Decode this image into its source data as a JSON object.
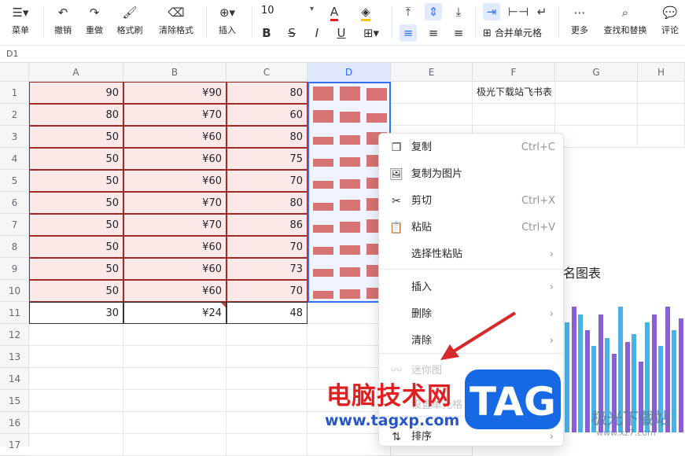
{
  "toolbar": {
    "menu": "菜单",
    "undo": "撤销",
    "redo": "重做",
    "format_painter": "格式刷",
    "clear_format": "清除格式",
    "insert": "插入",
    "font_size": "10",
    "merge_cells": "合并单元格",
    "more": "更多",
    "find_replace": "查找和替换",
    "comment": "评论"
  },
  "namebox": "D1",
  "columns": [
    "A",
    "B",
    "C",
    "D",
    "E",
    "F",
    "G",
    "H"
  ],
  "rows": [
    "1",
    "2",
    "3",
    "4",
    "5",
    "6",
    "7",
    "8",
    "9",
    "10",
    "11",
    "12",
    "13",
    "14",
    "15",
    "16",
    "17"
  ],
  "col_a": [
    "90",
    "80",
    "50",
    "50",
    "50",
    "50",
    "50",
    "50",
    "50",
    "50",
    "30"
  ],
  "col_b": [
    "¥90",
    "¥70",
    "¥60",
    "¥60",
    "¥60",
    "¥70",
    "¥70",
    "¥60",
    "¥60",
    "¥60",
    "¥24"
  ],
  "col_c": [
    "80",
    "60",
    "80",
    "75",
    "70",
    "80",
    "86",
    "70",
    "73",
    "70",
    "48"
  ],
  "f1_text": "极光下载站飞书表",
  "chart_title": "名图表",
  "context_menu": [
    {
      "icon": "copy-icon",
      "glyph": "❐",
      "label": "复制",
      "shortcut": "Ctrl+C"
    },
    {
      "icon": "copy-as-image-icon",
      "glyph": "🖼",
      "label": "复制为图片",
      "shortcut": ""
    },
    {
      "icon": "cut-icon",
      "glyph": "✂",
      "label": "剪切",
      "shortcut": "Ctrl+X"
    },
    {
      "icon": "paste-icon",
      "glyph": "📋",
      "label": "粘贴",
      "shortcut": "Ctrl+V"
    },
    {
      "icon": "",
      "glyph": "",
      "label": "选择性粘贴",
      "shortcut": "",
      "submenu": true
    },
    {
      "icon": "",
      "glyph": "",
      "label": "插入",
      "shortcut": "",
      "submenu": true
    },
    {
      "icon": "",
      "glyph": "",
      "label": "删除",
      "shortcut": "",
      "submenu": true
    },
    {
      "icon": "",
      "glyph": "",
      "label": "清除",
      "shortcut": "",
      "submenu": true
    },
    {
      "icon": "sparkline-icon",
      "glyph": "〰",
      "label": "迷你图",
      "shortcut": "",
      "submenu": true,
      "disabled": true
    },
    {
      "icon": "",
      "glyph": "",
      "label": "设置单元格数字格式",
      "shortcut": "",
      "disabled": true
    },
    {
      "icon": "sort-icon",
      "glyph": "⇅",
      "label": "排序",
      "shortcut": "",
      "submenu": true
    }
  ],
  "watermark": {
    "site_cn": "电脑技术网",
    "site_url": "www.tagxp.com",
    "tag": "TAG",
    "jg_cn": "极光下载站",
    "jg_url": "www.xz7.com"
  },
  "colors": {
    "accent": "#3370ff",
    "pink_fill": "#fde8e8",
    "bar_red": "#d77373",
    "arrow_red": "#d42a2a"
  }
}
